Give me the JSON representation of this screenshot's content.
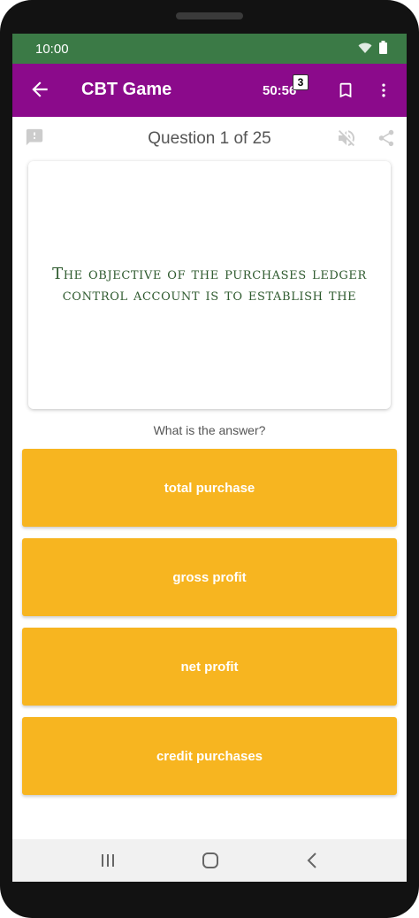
{
  "status_bar": {
    "time": "10:00"
  },
  "app_bar": {
    "title": "CBT Game",
    "timer": "50:56",
    "badge": "3"
  },
  "question": {
    "counter": "Question 1 of 25",
    "text": "The objective of the purchases ledger control account is to establish the"
  },
  "prompt": "What is the answer?",
  "options": [
    {
      "label": "total purchase"
    },
    {
      "label": "gross profit"
    },
    {
      "label": "net profit"
    },
    {
      "label": "credit purchases"
    }
  ],
  "colors": {
    "status_bar": "#3b7a46",
    "app_bar": "#8b0a8b",
    "option": "#f7b520",
    "question_text": "#2e5a2e"
  },
  "icons": {
    "back": "arrow-left-icon",
    "bookmark": "bookmark-icon",
    "menu": "more-vert-icon",
    "report": "feedback-icon",
    "mute": "volume-off-icon",
    "share": "share-icon"
  }
}
